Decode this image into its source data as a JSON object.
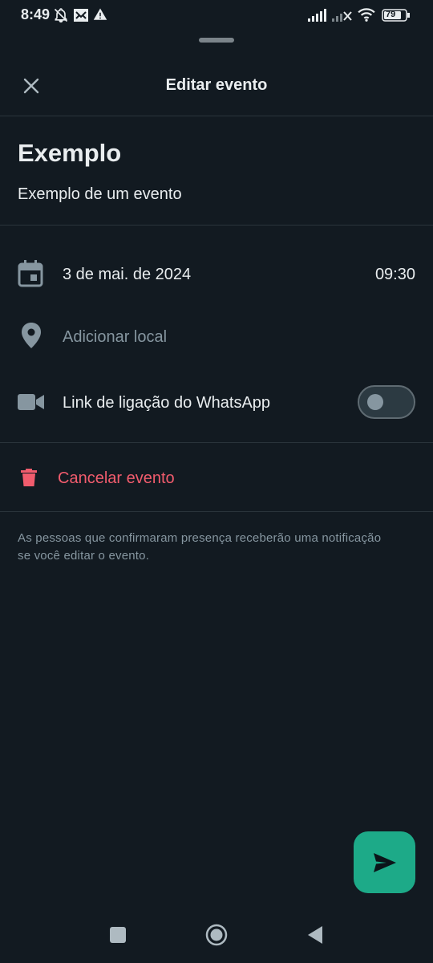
{
  "status_bar": {
    "time": "8:49",
    "battery": "79",
    "icons": [
      "mute-notification-icon",
      "app-notification-icon",
      "warning-icon",
      "signal-icon",
      "signal-off-icon",
      "wifi-icon",
      "battery-icon"
    ]
  },
  "header": {
    "title": "Editar evento",
    "close_icon": "close-icon"
  },
  "event": {
    "title": "Exemplo",
    "description": "Exemplo de um evento"
  },
  "details": {
    "date": "3 de mai. de 2024",
    "time": "09:30",
    "location_placeholder": "Adicionar local",
    "call_link_label": "Link de ligação do WhatsApp",
    "call_link_enabled": false
  },
  "cancel": {
    "label": "Cancelar evento"
  },
  "notice": "As pessoas que confirmaram presença receberão uma notificação se você editar o evento.",
  "colors": {
    "background": "#121a21",
    "text": "#e9edef",
    "secondary_text": "#8696a0",
    "danger": "#f15c6d",
    "accent": "#1daa88"
  },
  "fab": {
    "icon": "send-icon"
  },
  "nav_bar": {
    "icons": [
      "recents-icon",
      "home-icon",
      "back-icon"
    ]
  }
}
